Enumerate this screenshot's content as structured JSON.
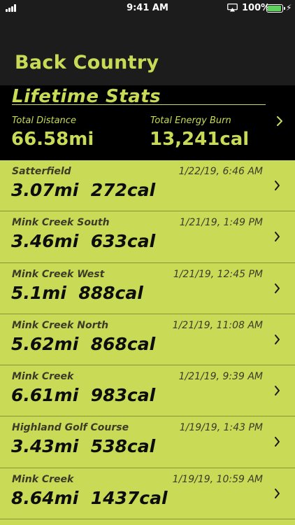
{
  "status_bar": {
    "time": "9:41 AM",
    "battery_percent": "100%",
    "battery_level": 1.0,
    "battery_color": "#5ed15f",
    "icons": [
      "signal-icon",
      "airplay-icon",
      "battery-icon",
      "charging-bolt-icon"
    ]
  },
  "nav": {
    "title": "Back Country"
  },
  "lifetime": {
    "title": "Lifetime Stats",
    "distance_label": "Total Distance",
    "distance_value": "66.58mi",
    "energy_label": "Total Energy Burn",
    "energy_value": "13,241cal"
  },
  "colors": {
    "accent": "#c9db56",
    "dark": "#1c1c1c",
    "black": "#000000"
  },
  "routes": [
    {
      "name": "Satterfield",
      "date": "1/22/19, 6:46 AM",
      "stats": "3.07mi  272cal"
    },
    {
      "name": "Mink Creek South",
      "date": "1/21/19, 1:49 PM",
      "stats": "3.46mi  633cal"
    },
    {
      "name": "Mink Creek West",
      "date": "1/21/19, 12:45 PM",
      "stats": "5.1mi  888cal"
    },
    {
      "name": "Mink Creek North",
      "date": "1/21/19, 11:08 AM",
      "stats": "5.62mi  868cal"
    },
    {
      "name": "Mink Creek",
      "date": "1/21/19, 9:39 AM",
      "stats": "6.61mi  983cal"
    },
    {
      "name": "Highland Golf Course",
      "date": "1/19/19, 1:43 PM",
      "stats": "3.43mi  538cal"
    },
    {
      "name": "Mink Creek",
      "date": "1/19/19, 10:59 AM",
      "stats": "8.64mi  1437cal"
    }
  ]
}
